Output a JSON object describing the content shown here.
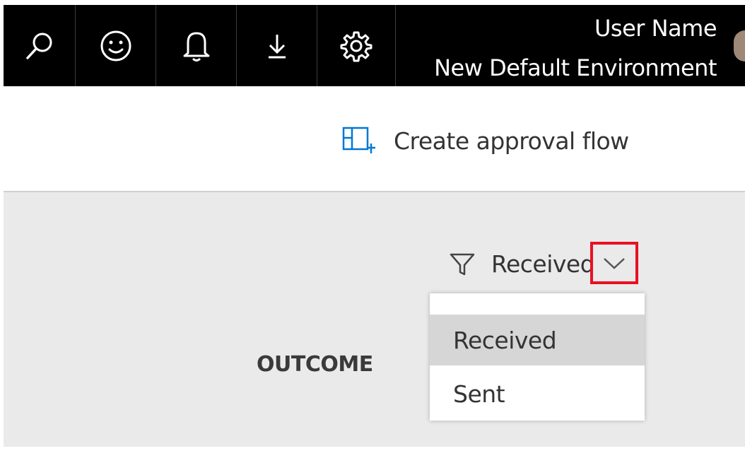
{
  "topbar": {
    "icons": [
      "search-icon",
      "smiley-icon",
      "bell-icon",
      "download-icon",
      "gear-icon"
    ],
    "user_name": "User Name",
    "environment": "New Default Environment"
  },
  "command_bar": {
    "create_flow_label": "Create approval flow",
    "create_flow_icon": "create-flow-icon",
    "accent_color": "#0078d4"
  },
  "filter": {
    "selected_label": "Received",
    "icon": "filter-icon",
    "dropdown_icon": "chevron-down-icon",
    "options": [
      {
        "label": "Received",
        "selected": true
      },
      {
        "label": "Sent",
        "selected": false
      }
    ]
  },
  "table": {
    "column_header": "OUTCOME"
  },
  "highlight_color": "#e81123"
}
